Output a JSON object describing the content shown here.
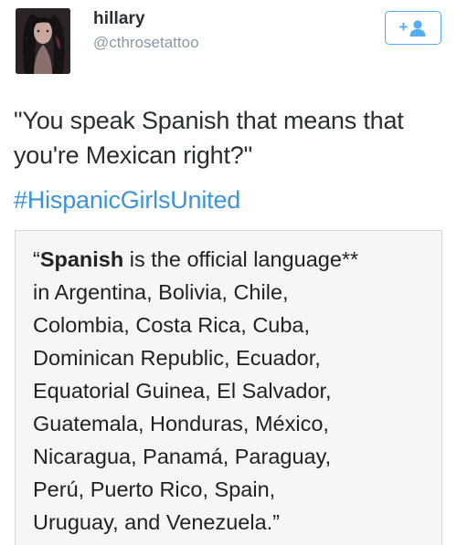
{
  "user": {
    "display_name": "hillary",
    "username": "@cthrosetattoo"
  },
  "follow_button": {
    "label": "+"
  },
  "tweet": {
    "text_line1": "\"You speak Spanish that means that",
    "text_line2": "you're Mexican right?\"",
    "hashtag": "#HispanicGirlsUnited"
  },
  "quote": {
    "open_quote": "“",
    "bold_word": "Spanish",
    "line1_rest": " is the official language**",
    "line2": "in Argentina, Bolivia, Chile,",
    "line3": "Colombia, Costa Rica, Cuba,",
    "line4": "Dominican Republic, Ecuador,",
    "line5": "Equatorial Guinea, El Salvador,",
    "line6": "Guatemala, Honduras, México,",
    "line7": "Nicaragua, Panamá, Paraguay,",
    "line8": "Perú, Puerto Rico, Spain,",
    "line9": "Uruguay, and Venezuela.”"
  },
  "colors": {
    "accent": "#55acee",
    "hashtag": "#3b94d9",
    "muted": "#8899a6",
    "card_bg": "#f5f6f7"
  }
}
